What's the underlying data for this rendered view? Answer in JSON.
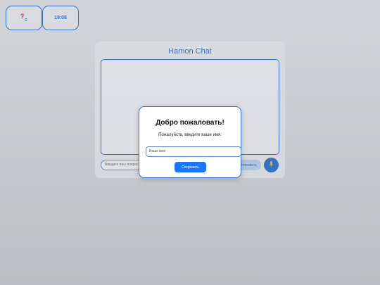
{
  "widgets": {
    "temperature": {
      "value": "?",
      "unit": "C"
    },
    "time": "19:08"
  },
  "chat": {
    "title": "Hamon Chat",
    "input_placeholder": "Введите ваш вопрос...",
    "send_label": "Отправить",
    "mic_icon": "microphone-icon"
  },
  "modal": {
    "title": "Добро пожаловать!",
    "prompt": "Пожалуйста, введите ваше имя:",
    "name_placeholder": "Ваше имя",
    "save_label": "Сохранить"
  },
  "colors": {
    "accent": "#2a72d8",
    "button": "#1677ff",
    "temperature_question": "#c0303a"
  }
}
